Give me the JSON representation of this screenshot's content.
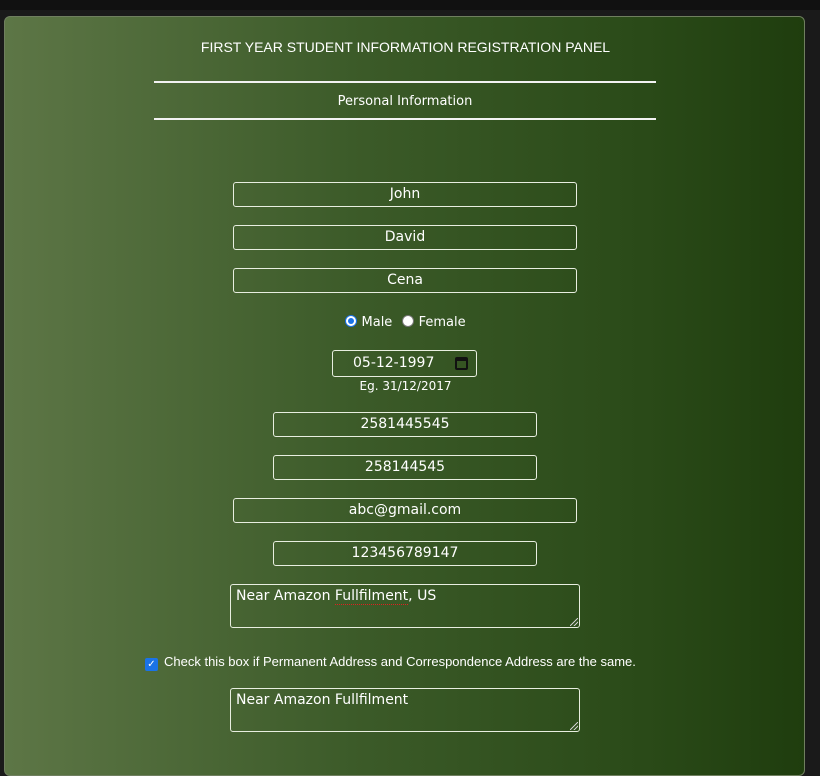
{
  "form": {
    "title": "FIRST YEAR STUDENT INFORMATION REGISTRATION PANEL",
    "section": "Personal Information",
    "first_name": "John",
    "middle_name": "David",
    "last_name": "Cena",
    "gender": {
      "male": "Male",
      "female": "Female",
      "selected": "Male"
    },
    "dob": "05-12-1997",
    "dob_hint": "Eg. 31/12/2017",
    "phone1": "2581445545",
    "phone2": "258144545",
    "email": "abc@gmail.com",
    "id_number": "123456789147",
    "address_correspondence": "Near Amazon Fullfilment, US",
    "address_correspondence_parts": [
      "Near Amazon ",
      "Fullfilment",
      ", US"
    ],
    "same_address_label": "Check this box if Permanent Address and Correspondence Address are the same.",
    "same_address_checked": true,
    "address_permanent": "Near Amazon Fullfilment"
  }
}
